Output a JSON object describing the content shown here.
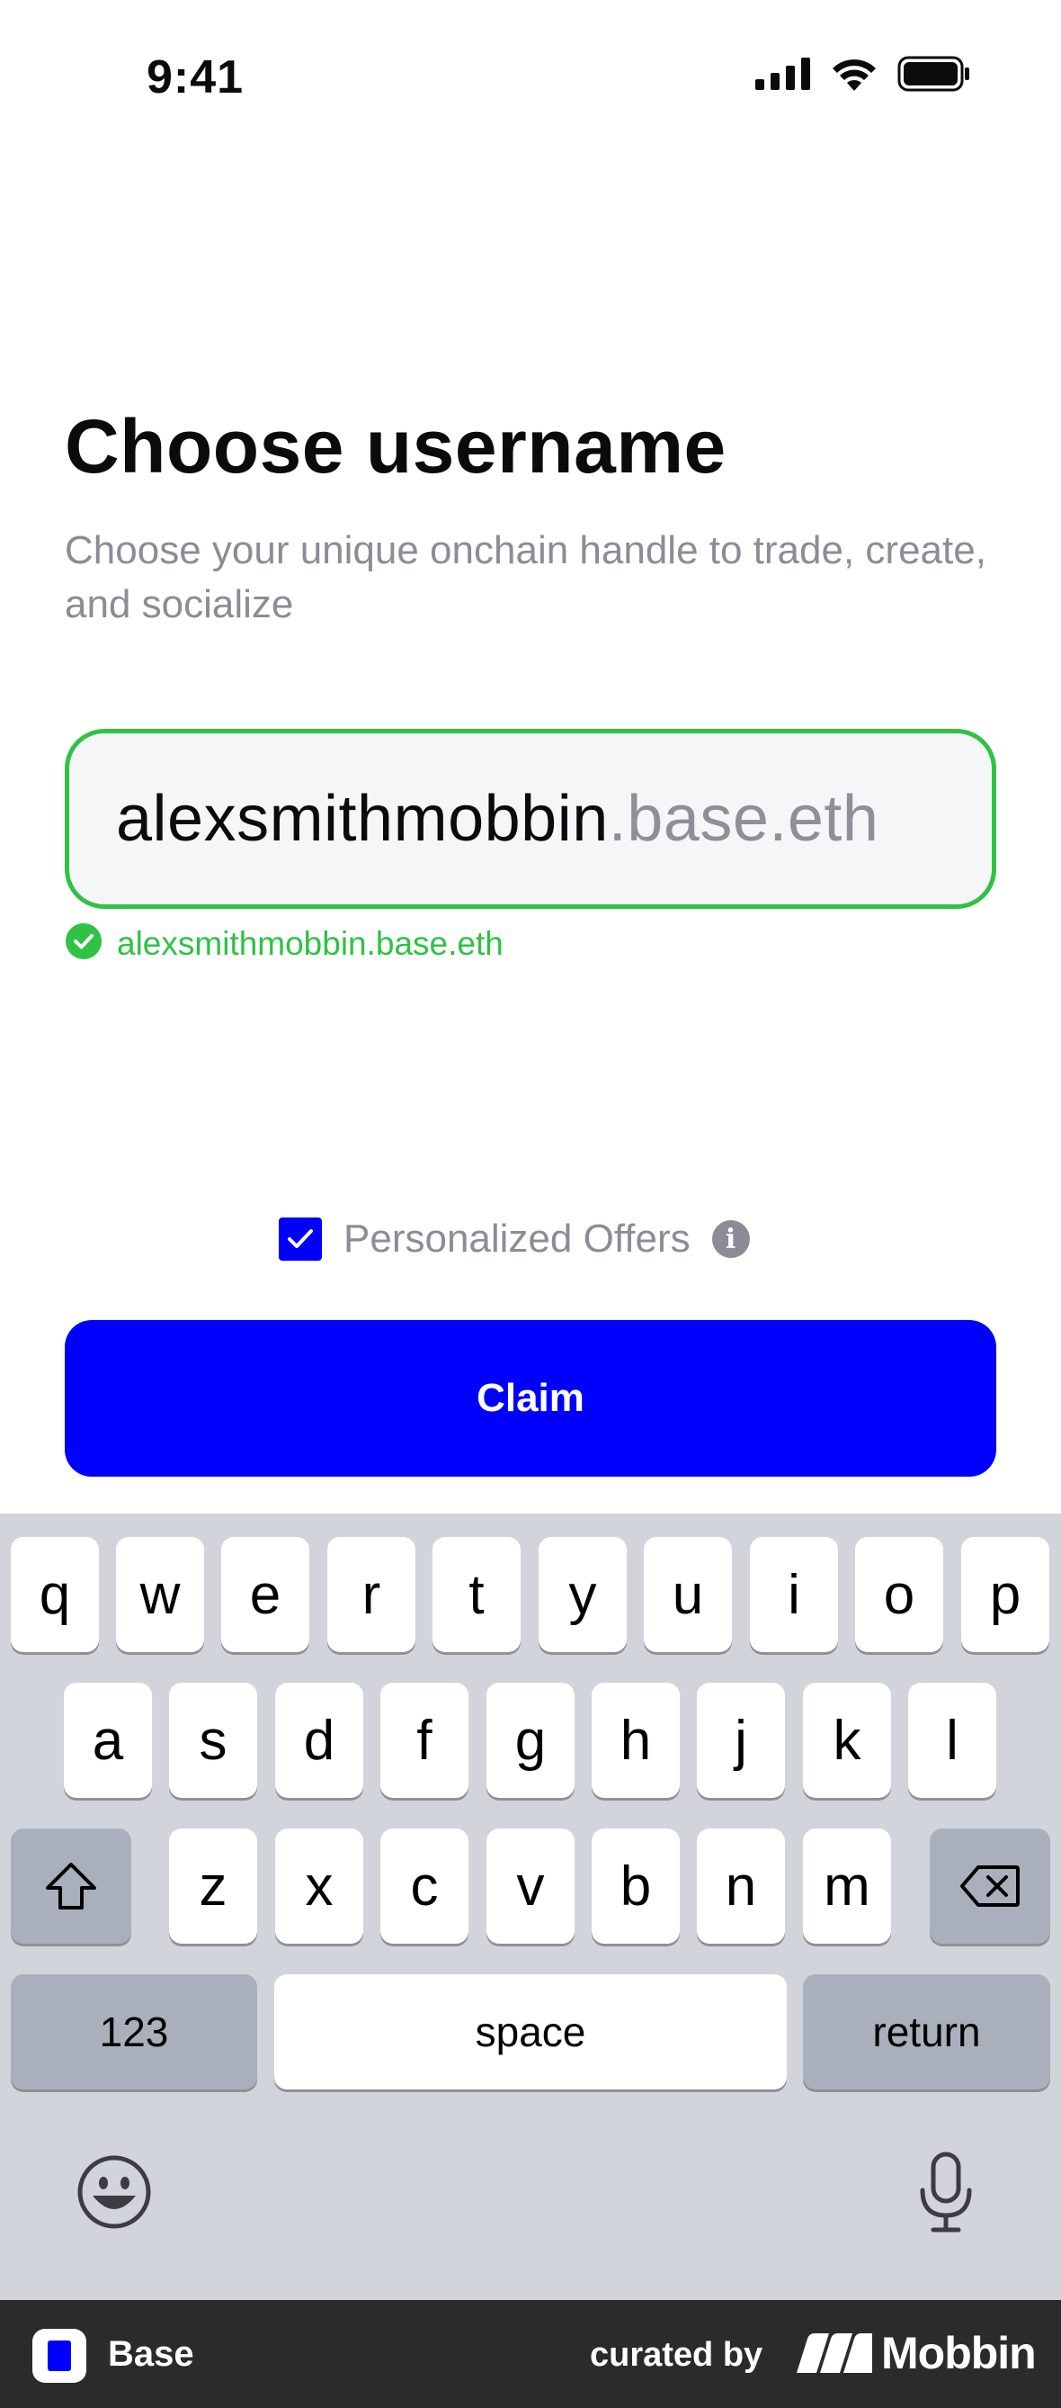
{
  "status_bar": {
    "time": "9:41",
    "icons": [
      "signal-icon",
      "wifi-icon",
      "battery-icon"
    ]
  },
  "header": {
    "title": "Choose username",
    "subtitle": "Choose your unique onchain handle to trade, create, and socialize"
  },
  "username": {
    "value": "alexsmithmobbin",
    "suffix": ".base.eth",
    "validation_text": "alexsmithmobbin.base.eth",
    "validation_icon": "check-circle-icon"
  },
  "offers": {
    "label": "Personalized Offers",
    "checked": true,
    "info_icon_glyph": "i"
  },
  "claim_button": {
    "label": "Claim"
  },
  "keyboard": {
    "row1": [
      "q",
      "w",
      "e",
      "r",
      "t",
      "y",
      "u",
      "i",
      "o",
      "p"
    ],
    "row2": [
      "a",
      "s",
      "d",
      "f",
      "g",
      "h",
      "j",
      "k",
      "l"
    ],
    "row3": [
      "z",
      "x",
      "c",
      "v",
      "b",
      "n",
      "m"
    ],
    "numbers_label": "123",
    "space_label": "space",
    "return_label": "return"
  },
  "footer": {
    "app_name": "Base",
    "curated_label": "curated by",
    "brand": "Mobbin"
  },
  "colors": {
    "accent": "#0000ff",
    "success": "#2fc244",
    "muted_text": "#8a8d96",
    "keyboard_bg": "#d1d4db"
  }
}
